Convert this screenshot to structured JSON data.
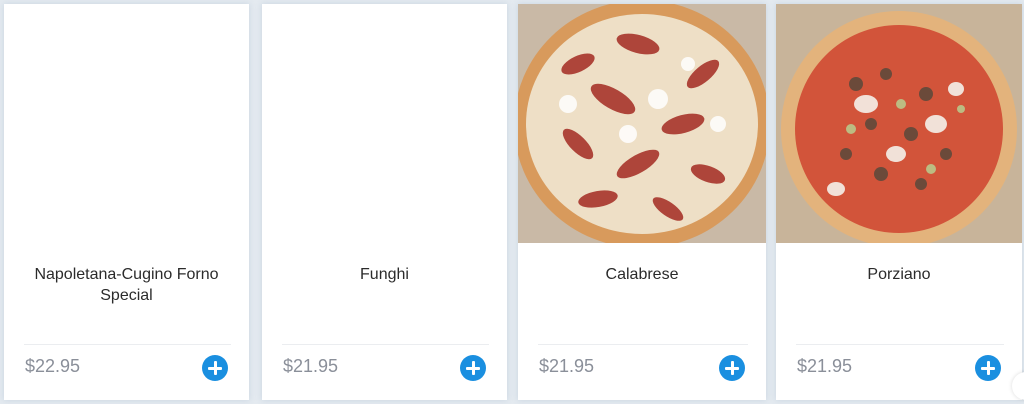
{
  "menu": {
    "items": [
      {
        "name": "Napoletana-Cugino Forno Special",
        "price": "$22.95",
        "image": null
      },
      {
        "name": "Funghi",
        "price": "$21.95",
        "image": null
      },
      {
        "name": "Calabrese",
        "price": "$21.95",
        "image": "calabrese-pizza-photo"
      },
      {
        "name": "Porziano",
        "price": "$21.95",
        "image": "porziano-pizza-photo"
      }
    ],
    "add_icon": "plus-circle-icon"
  },
  "colors": {
    "accent": "#1a8fe0",
    "price_text": "#8a8f99",
    "name_text": "#2b2b2b",
    "background": "#e4eaf0"
  }
}
